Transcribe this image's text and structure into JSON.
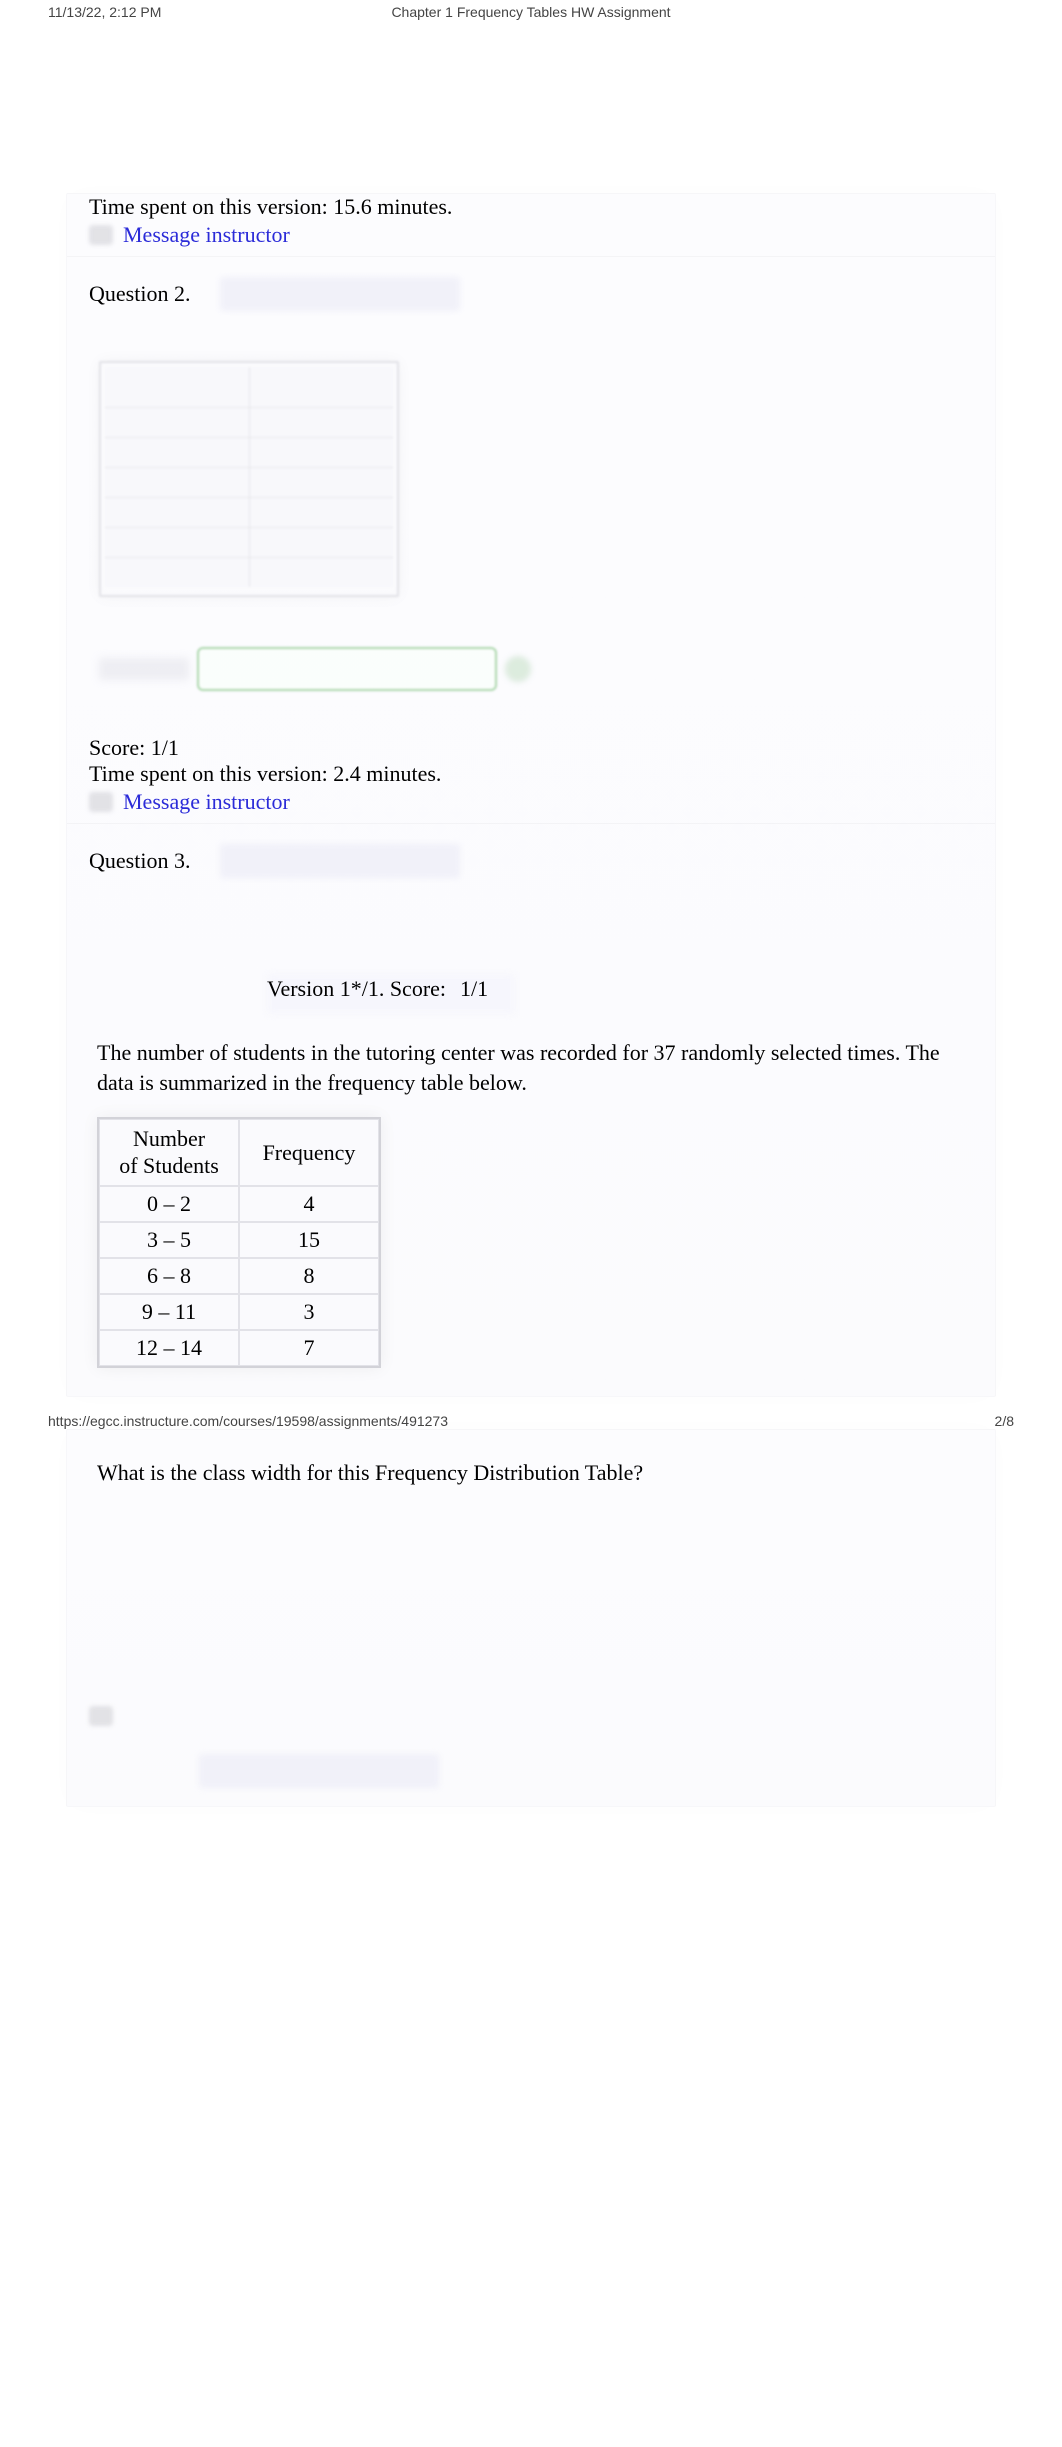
{
  "header": {
    "timestamp": "11/13/22, 2:12 PM",
    "title": "Chapter 1 Frequency Tables HW Assignment"
  },
  "q1_trailer": {
    "time_spent": "Time spent on this version: 15.6 minutes.",
    "message_link": "Message instructor"
  },
  "q2": {
    "label": "Question 2.",
    "score": "Score: 1/1",
    "time_spent": "Time spent on this version: 2.4 minutes.",
    "message_link": "Message instructor"
  },
  "q3": {
    "label": "Question 3.",
    "version_text": "Version 1*/1. Score:",
    "version_score": "1/1",
    "prompt": "The number of students in the tutoring center was recorded for 37 randomly selected times. The data is summarized in the frequency table below.",
    "table": {
      "col1_header_line1": "Number",
      "col1_header_line2": "of Students",
      "col2_header": "Frequency",
      "rows": [
        {
          "range": "0 – 2",
          "freq": "4"
        },
        {
          "range": "3 – 5",
          "freq": "15"
        },
        {
          "range": "6 – 8",
          "freq": "8"
        },
        {
          "range": "9 – 11",
          "freq": "3"
        },
        {
          "range": "12 – 14",
          "freq": "7"
        }
      ]
    },
    "followup_question": "What is the class width for this Frequency Distribution Table?"
  },
  "footer": {
    "url": "https://egcc.instructure.com/courses/19598/assignments/491273",
    "page": "2/8"
  }
}
